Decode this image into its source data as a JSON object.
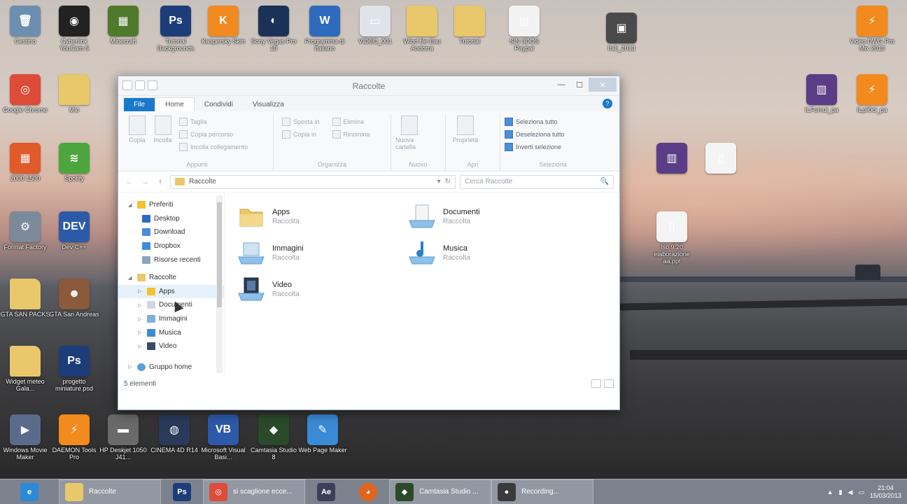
{
  "desktop": {
    "icons": [
      {
        "label": "Cestino",
        "color": "#6c8fb0",
        "glyph": "🗑"
      },
      {
        "label": "Cyberlink YouCam 5",
        "color": "#222222",
        "glyph": "◉"
      },
      {
        "label": "Minecraft",
        "color": "#4f7a2c",
        "glyph": "▦"
      },
      {
        "label": "Tutorial Backgrounds",
        "color": "#1c3d7a",
        "glyph": "Ps"
      },
      {
        "label": "Kaspersky Skin",
        "color": "#f08a20",
        "glyph": "K"
      },
      {
        "label": "Sony Vegas Pro 10",
        "color": "#1b3158",
        "glyph": "◐"
      },
      {
        "label": "Programma di Italiano",
        "color": "#2f6bbd",
        "glyph": "W"
      },
      {
        "label": "VIDEO_001",
        "color": "#dfe4ea",
        "glyph": "▭"
      },
      {
        "label": "Wind file Eau Andorra",
        "color": "#e8c86a",
        "glyph": ""
      },
      {
        "label": "Tutorial",
        "color": "#e8c86a",
        "glyph": ""
      },
      {
        "label": "SIN 3DOS Paypal",
        "color": "#f2f2f2",
        "glyph": "▤"
      },
      {
        "label": "Itali_2013",
        "color": "#4a4a4a",
        "glyph": "▣"
      },
      {
        "label": "Video DWG Pro Mix 2013",
        "color": "#f28a1e",
        "glyph": "⚡"
      },
      {
        "label": "Google Chrome",
        "color": "#dd4b39",
        "glyph": "◎"
      },
      {
        "label": "Mie",
        "color": "#e8c86a",
        "glyph": ""
      },
      {
        "label": "ILFomul_pa",
        "color": "#5a3d86",
        "glyph": "▥"
      },
      {
        "label": "ILpli0ci_pa",
        "color": "#f28a1e",
        "glyph": "⚡"
      },
      {
        "label": "2000 1500",
        "color": "#e05a2a",
        "glyph": "▦"
      },
      {
        "label": "Spotify",
        "color": "#4ca63d",
        "glyph": "≋"
      },
      {
        "label": "",
        "color": "#5a3d86",
        "glyph": "▥"
      },
      {
        "label": "",
        "color": "#f4f4f4",
        "glyph": "▯"
      },
      {
        "label": "Format Factory",
        "color": "#7a8a9a",
        "glyph": "⚙"
      },
      {
        "label": "Dev C++",
        "color": "#2d5aa8",
        "glyph": "DEV"
      },
      {
        "label": "Iso 9:20 elaborazione aa.ppt",
        "color": "#f4f4f4",
        "glyph": "▯"
      },
      {
        "label": "GTA SAN PACKS",
        "color": "#e8c86a",
        "glyph": ""
      },
      {
        "label": "GTA San Andreas",
        "color": "#8a5a3a",
        "glyph": "☻"
      },
      {
        "label": "Widget meteo Gala...",
        "color": "#e8c86a",
        "glyph": ""
      },
      {
        "label": "progetto miniature.psd",
        "color": "#1c3d7a",
        "glyph": "Ps"
      },
      {
        "label": "Windows Movie Maker",
        "color": "#5a6a8a",
        "glyph": "▶"
      },
      {
        "label": "DAEMON Tools Pro",
        "color": "#f28a1e",
        "glyph": "⚡"
      },
      {
        "label": "HP Deskjet 1050 J41...",
        "color": "#6a6a6a",
        "glyph": "▬"
      },
      {
        "label": "CINEMA 4D R14",
        "color": "#2a3a5a",
        "glyph": "◍"
      },
      {
        "label": "Microsoft Visual Basi...",
        "color": "#2d5aa8",
        "glyph": "VB"
      },
      {
        "label": "Camtasia Studio 8",
        "color": "#2a4a2a",
        "glyph": "◆"
      },
      {
        "label": "Web Page Maker",
        "color": "#3a8ad6",
        "glyph": "✎"
      }
    ]
  },
  "window": {
    "title": "Raccolte",
    "controls": {
      "minimize": "—",
      "maximize": "☐",
      "close": "✕"
    },
    "tabs": [
      {
        "label": "File"
      },
      {
        "label": "Home"
      },
      {
        "label": "Condividi"
      },
      {
        "label": "Visualizza"
      }
    ],
    "help": "?",
    "ribbon": {
      "appunti": {
        "name": "Appunti",
        "copy": "Copia",
        "paste": "Incolla",
        "cut": "Taglia",
        "copy_path": "Copia percorso",
        "paste_shortcut": "Incolla collegamento"
      },
      "organizza": {
        "name": "Organizza",
        "move_to": "Sposta in",
        "copy_to": "Copia in",
        "delete": "Elimina",
        "rename": "Rinomina"
      },
      "nuovo": {
        "name": "Nuovo",
        "new_folder": "Nuova cartella"
      },
      "apri": {
        "name": "Apri",
        "properties": "Proprietà"
      },
      "seleziona": {
        "name": "Seleziona",
        "select_all": "Seleziona tutto",
        "select_none": "Deseleziona tutto",
        "invert": "Inverti selezione"
      }
    },
    "address": {
      "back": "←",
      "forward": "→",
      "up": "↑",
      "path": "Raccolte",
      "search_placeholder": "Cerca Raccolte",
      "search_icon": "🔍"
    },
    "nav": {
      "favorites": "Preferiti",
      "desktop": "Desktop",
      "download": "Download",
      "dropbox": "Dropbox",
      "recent": "Risorse recenti",
      "libraries": "Raccolte",
      "apps": "Apps",
      "documents": "Documenti",
      "images": "Immagini",
      "music": "Musica",
      "video": "Video",
      "homegroup": "Gruppo home"
    },
    "libraries": [
      {
        "name": "Apps",
        "sub": "Raccolta"
      },
      {
        "name": "Documenti",
        "sub": "Raccolta"
      },
      {
        "name": "Immagini",
        "sub": "Raccolta"
      },
      {
        "name": "Musica",
        "sub": "Raccolta"
      },
      {
        "name": "Video",
        "sub": "Raccolta"
      }
    ],
    "status": "5 elementi"
  },
  "taskbar": {
    "raccolte": "Raccolte",
    "chrome": "si scaglione ecce...",
    "camtasia": "Camtasia Studio ...",
    "recording": "Recording...",
    "time": "21:04",
    "date": "15/03/2013"
  }
}
